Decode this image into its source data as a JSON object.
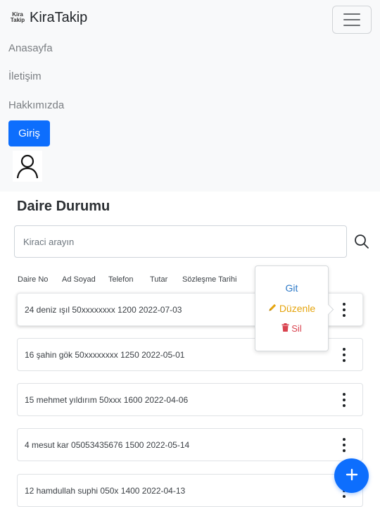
{
  "brand": {
    "logo_line1": "Kira",
    "logo_line2": "Takip",
    "name": "KiraTakip"
  },
  "nav": {
    "items": [
      "Anasayfa",
      "İletişim",
      "Hakkımızda"
    ],
    "login_label": "Giriş"
  },
  "page": {
    "title": "Daire Durumu"
  },
  "search": {
    "placeholder": "Kiraci arayın",
    "value": ""
  },
  "table": {
    "headers": [
      "Daire No",
      "Ad Soyad",
      "Telefon",
      "Tutar",
      "Sözleşme Tarihi"
    ],
    "rows": [
      "24 deniz ışıl 50xxxxxxxx 1200 2022-07-03",
      "16 şahin gök 50xxxxxxxx 1250 2022-05-01",
      "15 mehmet yıldırım 50xxx 1600 2022-04-06",
      "4 mesut kar 05053435676 1500 2022-05-14",
      "12 hamdullah suphi 050x 1400 2022-04-13"
    ]
  },
  "dropdown": {
    "go": "Git",
    "edit": "Düzenle",
    "delete": "Sil"
  },
  "icons": {
    "menu": "hamburger-icon",
    "user": "user-icon",
    "search": "search-icon",
    "more": "kebab-icon",
    "edit": "pencil-icon",
    "delete": "trash-icon",
    "add": "plus-icon"
  },
  "colors": {
    "primary": "#0d6efd",
    "navbar_bg": "#f8f9fa",
    "link_blue": "#2d79c7",
    "warning": "#e5a40d",
    "danger": "#d9434f"
  }
}
